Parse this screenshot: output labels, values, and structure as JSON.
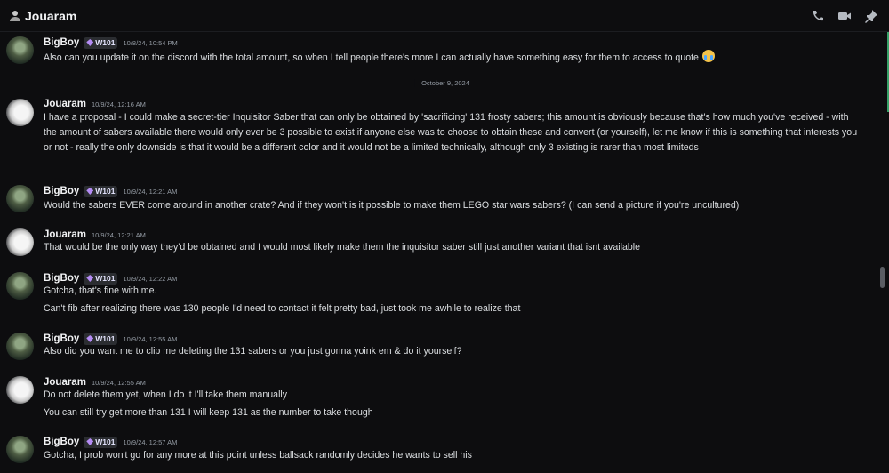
{
  "header": {
    "title": "Jouaram",
    "icons": [
      "user-icon",
      "phone-icon",
      "video-icon",
      "pin-icon"
    ]
  },
  "divider": {
    "date": "October 9, 2024"
  },
  "messages": [
    {
      "author": "BigBoy",
      "tag": "W101",
      "time": "10/8/24, 10:54 PM",
      "lines": [
        "Also can you update it on the discord with the total amount, so when I tell people there's more I can actually have something easy for them to access to quote"
      ],
      "emoji": "crying-face"
    },
    {
      "author": "Jouaram",
      "time": "10/9/24, 12:16 AM",
      "paragraph": "I have a proposal - I could make a secret-tier Inquisitor Saber that can only be obtained by 'sacrificing' 131 frosty sabers; this amount is obviously because that's how much you've received - with the amount of sabers available there would only ever be 3 possible to exist if anyone else was to choose to obtain these and convert (or yourself), let me know if this is something that interests you or not - really the only downside is that it would be a different color and it would not be a limited technically, although only 3 existing is rarer than most limiteds"
    },
    {
      "author": "BigBoy",
      "tag": "W101",
      "time": "10/9/24, 12:21 AM",
      "lines": [
        "Would the sabers EVER come around in another crate? And if they won't is it possible to make them LEGO star wars sabers? (I can send a picture if you're uncultured)"
      ]
    },
    {
      "author": "Jouaram",
      "time": "10/9/24, 12:21 AM",
      "lines": [
        "That would be the only way they'd be obtained and I would most likely make them the inquisitor saber still just another variant that isnt available"
      ]
    },
    {
      "author": "BigBoy",
      "tag": "W101",
      "time": "10/9/24, 12:22 AM",
      "lines": [
        "Gotcha, that's fine with me.",
        "Can't fib after realizing there was 130 people I'd need to contact it felt pretty bad, just took me awhile to realize that"
      ]
    },
    {
      "author": "BigBoy",
      "tag": "W101",
      "time": "10/9/24, 12:55 AM",
      "lines": [
        "Also did you want me to clip me deleting the 131 sabers or you just gonna yoink em & do it yourself?"
      ]
    },
    {
      "author": "Jouaram",
      "time": "10/9/24, 12:55 AM",
      "lines": [
        "Do not delete them yet, when I do it I'll take them manually",
        "You can still try get more than 131 I will keep 131 as the number to take though"
      ]
    },
    {
      "author": "BigBoy",
      "tag": "W101",
      "time": "10/9/24, 12:57 AM",
      "lines": [
        "Gotcha, I prob won't go for any more at this point unless ballsack randomly decides he wants to sell his"
      ]
    }
  ]
}
